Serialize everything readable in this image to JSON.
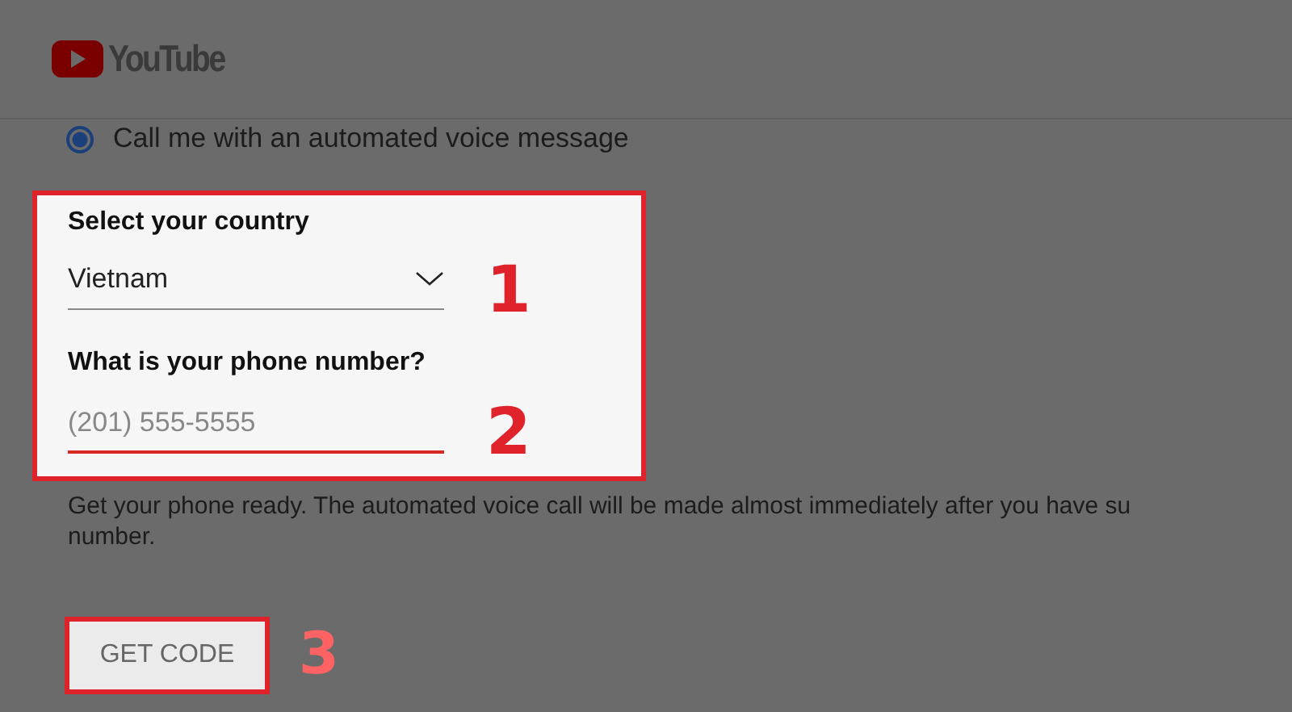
{
  "header": {
    "logo_text": "YouTube"
  },
  "radio": {
    "label": "Call me with an automated voice message",
    "selected": true
  },
  "country": {
    "label": "Select your country",
    "value": "Vietnam"
  },
  "phone": {
    "label": "What is your phone number?",
    "placeholder": "(201) 555-5555"
  },
  "description": [
    "Get your phone ready. The automated voice call will be made almost immediately after you have su",
    "number."
  ],
  "button": {
    "label": "GET CODE"
  },
  "annotations": [
    "1",
    "2",
    "3"
  ]
}
